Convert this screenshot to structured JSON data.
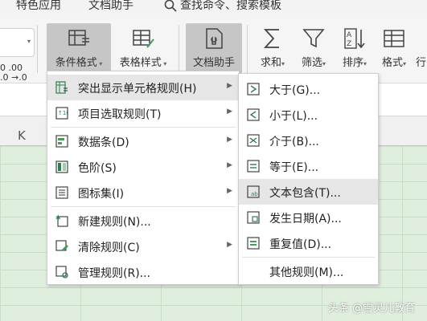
{
  "tabs": [
    {
      "label": "特色应用"
    },
    {
      "label": "文档助手"
    }
  ],
  "search": {
    "label": "查找命令、搜索模板"
  },
  "ribbon": {
    "conditional_format": "条件格式",
    "table_style": "表格样式",
    "doc_helper": "文档助手",
    "sum": "求和",
    "filter": "筛选",
    "sort": "排序",
    "format": "格式",
    "row": "行"
  },
  "left_numbers": {
    "line1": "0 .00",
    "line2": ".0 →.0"
  },
  "column_header": {
    "k": "K"
  },
  "menu_main": {
    "items": [
      {
        "label": "突出显示单元格规则(H)",
        "submenu": true
      },
      {
        "label": "项目选取规则(T)",
        "submenu": true
      },
      {
        "label": "数据条(D)",
        "submenu": true
      },
      {
        "label": "色阶(S)",
        "submenu": true
      },
      {
        "label": "图标集(I)",
        "submenu": true
      },
      {
        "label": "新建规则(N)...",
        "submenu": false
      },
      {
        "label": "清除规则(C)",
        "submenu": true
      },
      {
        "label": "管理规则(R)...",
        "submenu": false
      }
    ]
  },
  "menu_sub": {
    "items": [
      {
        "label": "大于(G)..."
      },
      {
        "label": "小于(L)..."
      },
      {
        "label": "介于(B)..."
      },
      {
        "label": "等于(E)..."
      },
      {
        "label": "文本包含(T)..."
      },
      {
        "label": "发生日期(A)..."
      },
      {
        "label": "重复值(D)..."
      },
      {
        "label": "其他规则(M)..."
      }
    ]
  },
  "watermark": {
    "text": "头条 @雪灵儿教育"
  },
  "colors": {
    "highlight": "#e6e6e6",
    "grid": "#dfeedd",
    "active": "#c6c6c6"
  }
}
